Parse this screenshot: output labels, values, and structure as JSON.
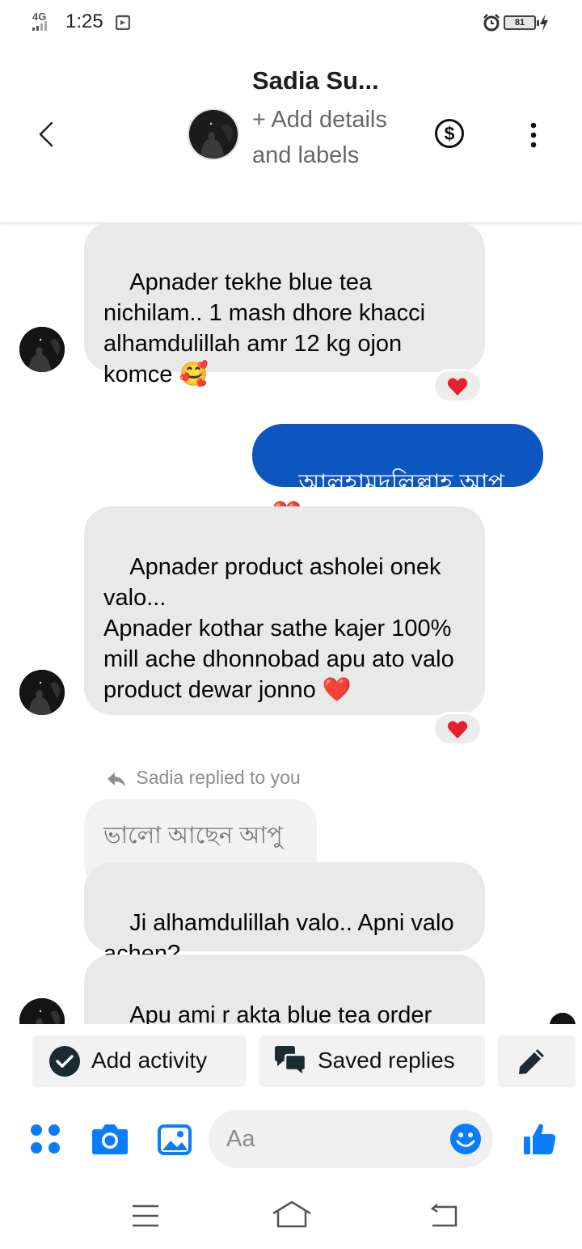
{
  "status_bar": {
    "network": "4G",
    "time": "1:25",
    "battery": "81"
  },
  "header": {
    "contact_name": "Sadia Su...",
    "add_details": "+ Add details and labels",
    "back_icon": "chevron-left-icon",
    "money_icon": "dollar-circle-icon",
    "more_icon": "more-vertical-icon"
  },
  "messages": [
    {
      "direction": "in",
      "text": "Apnader tekhe blue tea nichilam.. 1 mash dhore khacci alhamdulillah amr 12 kg ojon komce 🥰",
      "reaction": "heart"
    },
    {
      "direction": "out",
      "text": "আলহামদুলিল্লাহ আপু❤️"
    },
    {
      "direction": "in",
      "text": "Apnader product asholei onek valo...\nApnader kothar sathe kajer 100% mill ache dhonnobad apu ato valo product dewar jonno ❤️",
      "reaction": "heart"
    },
    {
      "direction": "in",
      "reply_note": "Sadia replied to you",
      "quoted": "ভালো আছেন আপু",
      "text": "Ji alhamdulillah valo.. Apni valo achen?"
    },
    {
      "direction": "in",
      "text": "Apu ami r akta blue tea order korte chacci amr ammur jonno"
    }
  ],
  "quick_actions": {
    "add_activity": "Add activity",
    "saved_replies": "Saved replies",
    "edit_icon": "pencil-icon"
  },
  "composer": {
    "placeholder": "Aa"
  },
  "colors": {
    "accent": "#0a7cff",
    "outgoing_bubble": "#0d56c0",
    "incoming_bubble": "#e9e9e9",
    "reaction_heart": "#e8202e"
  }
}
